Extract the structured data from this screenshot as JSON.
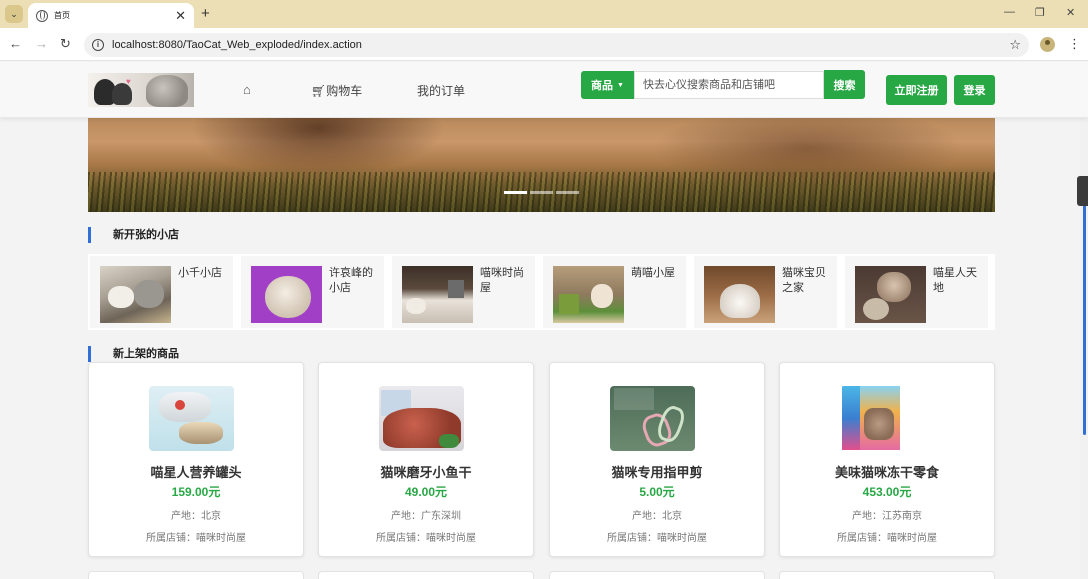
{
  "browser": {
    "tab_title": "首页",
    "url": "localhost:8080/TaoCat_Web_exploded/index.action"
  },
  "navbar": {
    "home_icon": "home-icon",
    "cart_label": "购物车",
    "orders_label": "我的订单",
    "search_category": "商品",
    "search_placeholder": "快去心仪搜索商品和店铺吧",
    "search_button": "搜索",
    "register_button": "立即注册",
    "login_button": "登录"
  },
  "colors": {
    "accent_green": "#28a745",
    "section_bar_blue": "#2f6fd6",
    "price_green": "#28a745"
  },
  "carousel": {
    "slide_count": 3,
    "active_index": 0
  },
  "new_stores_section": {
    "title": "新开张的小店",
    "stores": [
      {
        "name": "小千小店"
      },
      {
        "name": "许哀峰的小店"
      },
      {
        "name": "喵咪时尚屋"
      },
      {
        "name": "萌喵小屋"
      },
      {
        "name": "猫咪宝贝之家"
      },
      {
        "name": "喵星人天地"
      }
    ]
  },
  "new_products_section": {
    "title": "新上架的商品",
    "products": [
      {
        "name": "喵星人营养罐头",
        "price": "159.00元",
        "origin": "产地：北京",
        "store": "所属店铺：喵咪时尚屋"
      },
      {
        "name": "猫咪磨牙小鱼干",
        "price": "49.00元",
        "origin": "产地：广东深圳",
        "store": "所属店铺：喵咪时尚屋"
      },
      {
        "name": "猫咪专用指甲剪",
        "price": "5.00元",
        "origin": "产地：北京",
        "store": "所属店铺：喵咪时尚屋"
      },
      {
        "name": "美味猫咪冻干零食",
        "price": "453.00元",
        "origin": "产地：江苏南京",
        "store": "所属店铺：喵咪时尚屋"
      }
    ]
  }
}
